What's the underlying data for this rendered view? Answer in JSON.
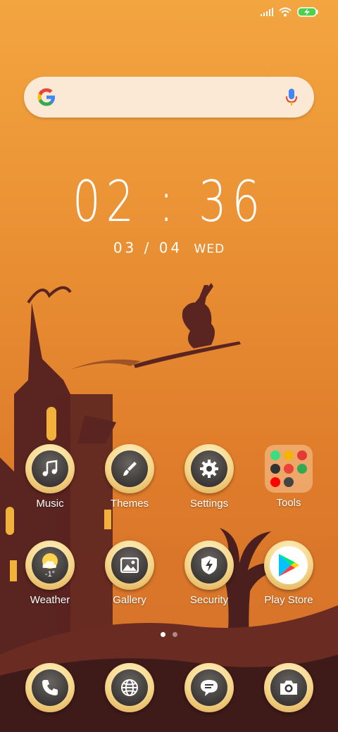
{
  "clock": {
    "time": "02 : 36",
    "date": "03 / 04",
    "weekday": "WED"
  },
  "weather": {
    "temp": "-1°"
  },
  "apps": {
    "music": "Music",
    "themes": "Themes",
    "settings": "Settings",
    "tools": "Tools",
    "weather": "Weather",
    "gallery": "Gallery",
    "security": "Security",
    "playstore": "Play Store"
  },
  "dock": {
    "items": [
      {
        "icon": "phone-icon"
      },
      {
        "icon": "browser-globe-icon"
      },
      {
        "icon": "messages-icon"
      },
      {
        "icon": "camera-icon"
      }
    ]
  },
  "pager": {
    "pages": 2,
    "current": 1
  },
  "status": {
    "battery": "charging"
  },
  "colors": {
    "sky_top": "#f3a540",
    "sky_bottom": "#d56d27",
    "silhouette": "#4a1f1d",
    "accent_gold": "#f6d68a"
  }
}
